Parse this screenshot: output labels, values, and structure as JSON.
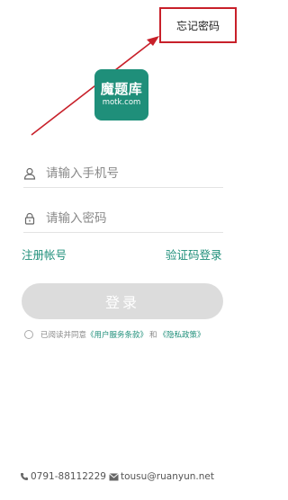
{
  "header": {
    "forgot_password": "忘记密码"
  },
  "logo": {
    "title_cn": "魔题库",
    "domain": "motk.com"
  },
  "form": {
    "phone_placeholder": "请输入手机号",
    "password_placeholder": "请输入密码",
    "register_link": "注册帐号",
    "code_login_link": "验证码登录",
    "login_button": "登录"
  },
  "agreement": {
    "prefix": "已阅读并同意",
    "terms": "《用户服务条款》",
    "and": "和",
    "privacy": "《隐私政策》"
  },
  "contact": {
    "phone": "0791-88112229",
    "email": "tousu@ruanyun.net"
  },
  "colors": {
    "accent": "#1f8f7a",
    "highlight": "#c8202a",
    "button_disabled": "#dcdcdc"
  }
}
